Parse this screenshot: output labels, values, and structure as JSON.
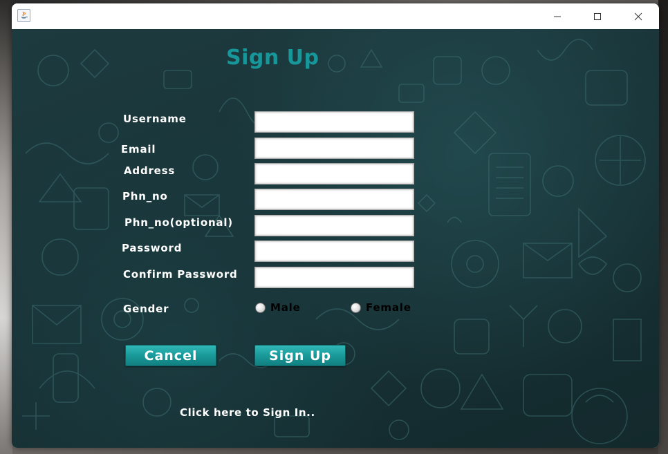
{
  "window": {
    "title": "",
    "controls": {
      "minimize": "minimize-icon",
      "maximize": "maximize-icon",
      "close": "close-icon"
    },
    "app_icon": "java-icon"
  },
  "form": {
    "title": "Sign Up",
    "fields": [
      {
        "label": "Username",
        "value": "",
        "placeholder": ""
      },
      {
        "label": "Email",
        "value": "",
        "placeholder": ""
      },
      {
        "label": "Address",
        "value": "",
        "placeholder": ""
      },
      {
        "label": "Phn_no",
        "value": "",
        "placeholder": ""
      },
      {
        "label": "Phn_no(optional)",
        "value": "",
        "placeholder": ""
      },
      {
        "label": "Password",
        "value": "",
        "placeholder": ""
      },
      {
        "label": "Confirm Password",
        "value": "",
        "placeholder": ""
      }
    ],
    "gender": {
      "label": "Gender",
      "options": [
        "Male",
        "Female"
      ],
      "selected": null
    },
    "buttons": {
      "cancel": "Cancel",
      "signup": "Sign Up"
    },
    "signin_link": "Click here to Sign In.."
  },
  "colors": {
    "title": "#17979a",
    "button": "#1b9c9c",
    "background": "#183236"
  }
}
